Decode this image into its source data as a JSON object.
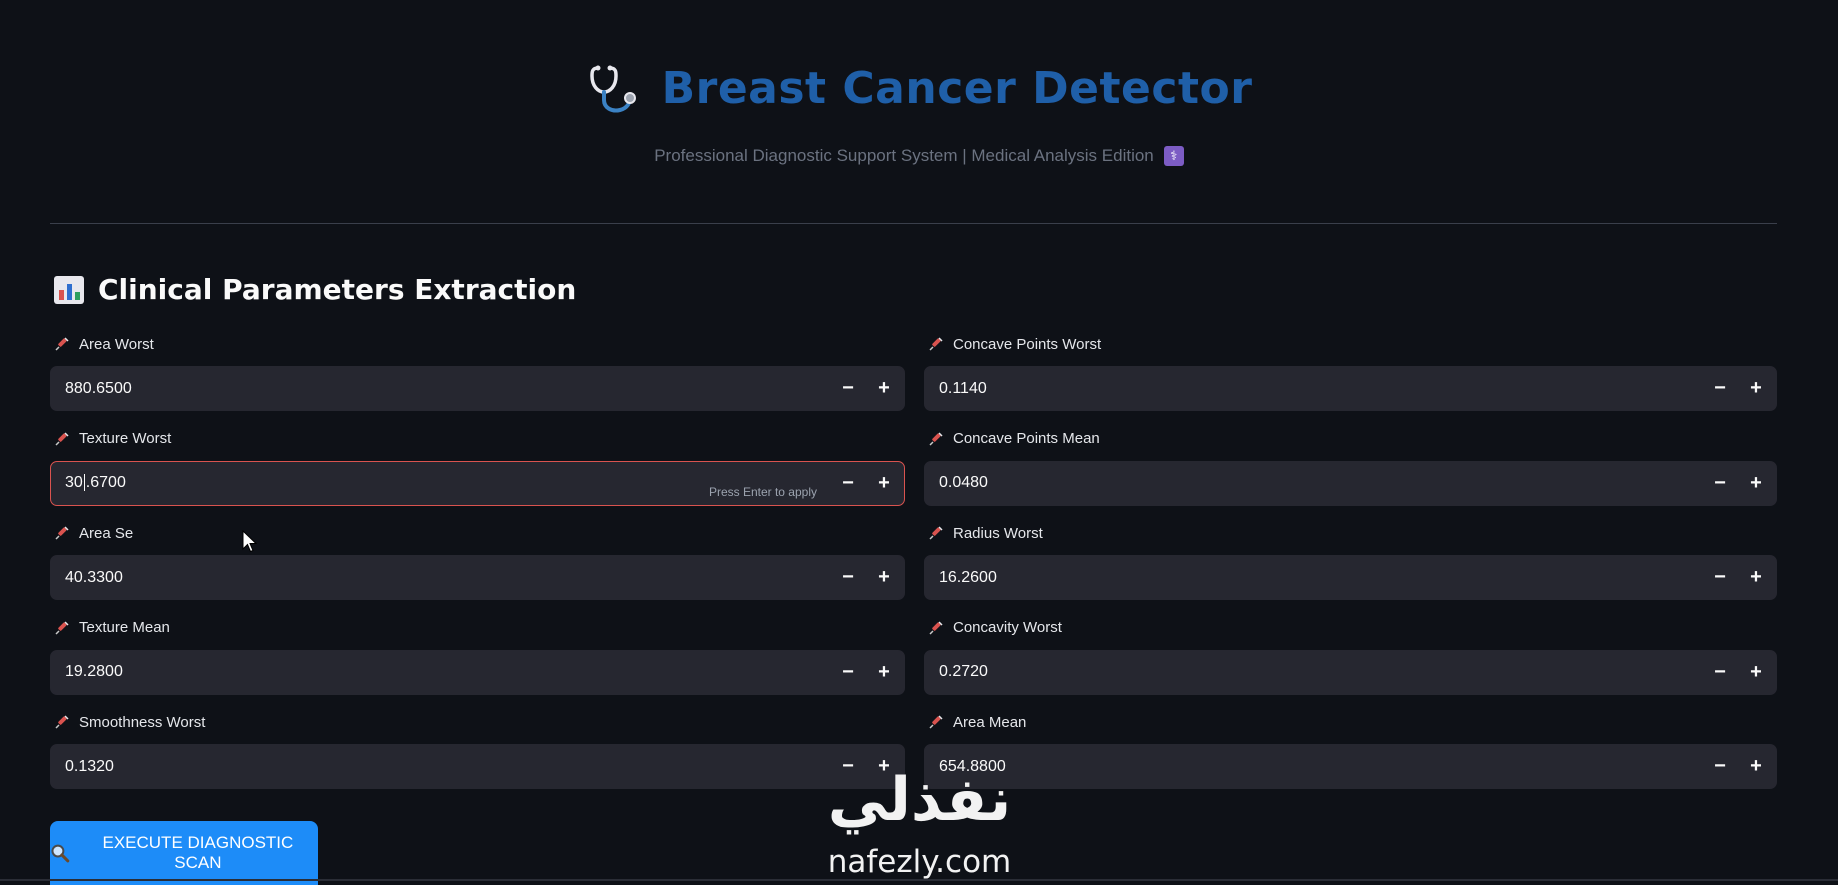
{
  "header": {
    "title": "Breast Cancer Detector",
    "subtitle": "Professional Diagnostic Support System | Medical Analysis Edition",
    "title_icon": "stethoscope-icon",
    "subtitle_icon": "caduceus-icon",
    "title_color": "#1f5fa8"
  },
  "section": {
    "title": "Clinical Parameters Extraction",
    "icon": "bar-chart-icon"
  },
  "fields_left": [
    {
      "label": "Area Worst",
      "value": "880.6500"
    },
    {
      "label": "Texture Worst",
      "value": "30.6700",
      "focused": true,
      "hint": "Press Enter to apply"
    },
    {
      "label": "Area Se",
      "value": "40.3300"
    },
    {
      "label": "Texture Mean",
      "value": "19.2800"
    },
    {
      "label": "Smoothness Worst",
      "value": "0.1320"
    }
  ],
  "fields_right": [
    {
      "label": "Concave Points Worst",
      "value": "0.1140"
    },
    {
      "label": "Concave Points Mean",
      "value": "0.0480"
    },
    {
      "label": "Radius Worst",
      "value": "16.2600"
    },
    {
      "label": "Concavity Worst",
      "value": "0.2720"
    },
    {
      "label": "Area Mean",
      "value": "654.8800"
    }
  ],
  "stepper": {
    "minus": "−",
    "plus": "+"
  },
  "field_icon": "syringe-icon",
  "action": {
    "label": "EXECUTE DIAGNOSTIC SCAN",
    "icon": "magnifier-icon",
    "color": "#1d8cf8"
  },
  "watermark": {
    "arabic": "نفذلي",
    "latin": "nafezly.com"
  },
  "colors": {
    "background": "#0e1117",
    "input_bg": "#262730",
    "focus_border": "#d9534f"
  }
}
